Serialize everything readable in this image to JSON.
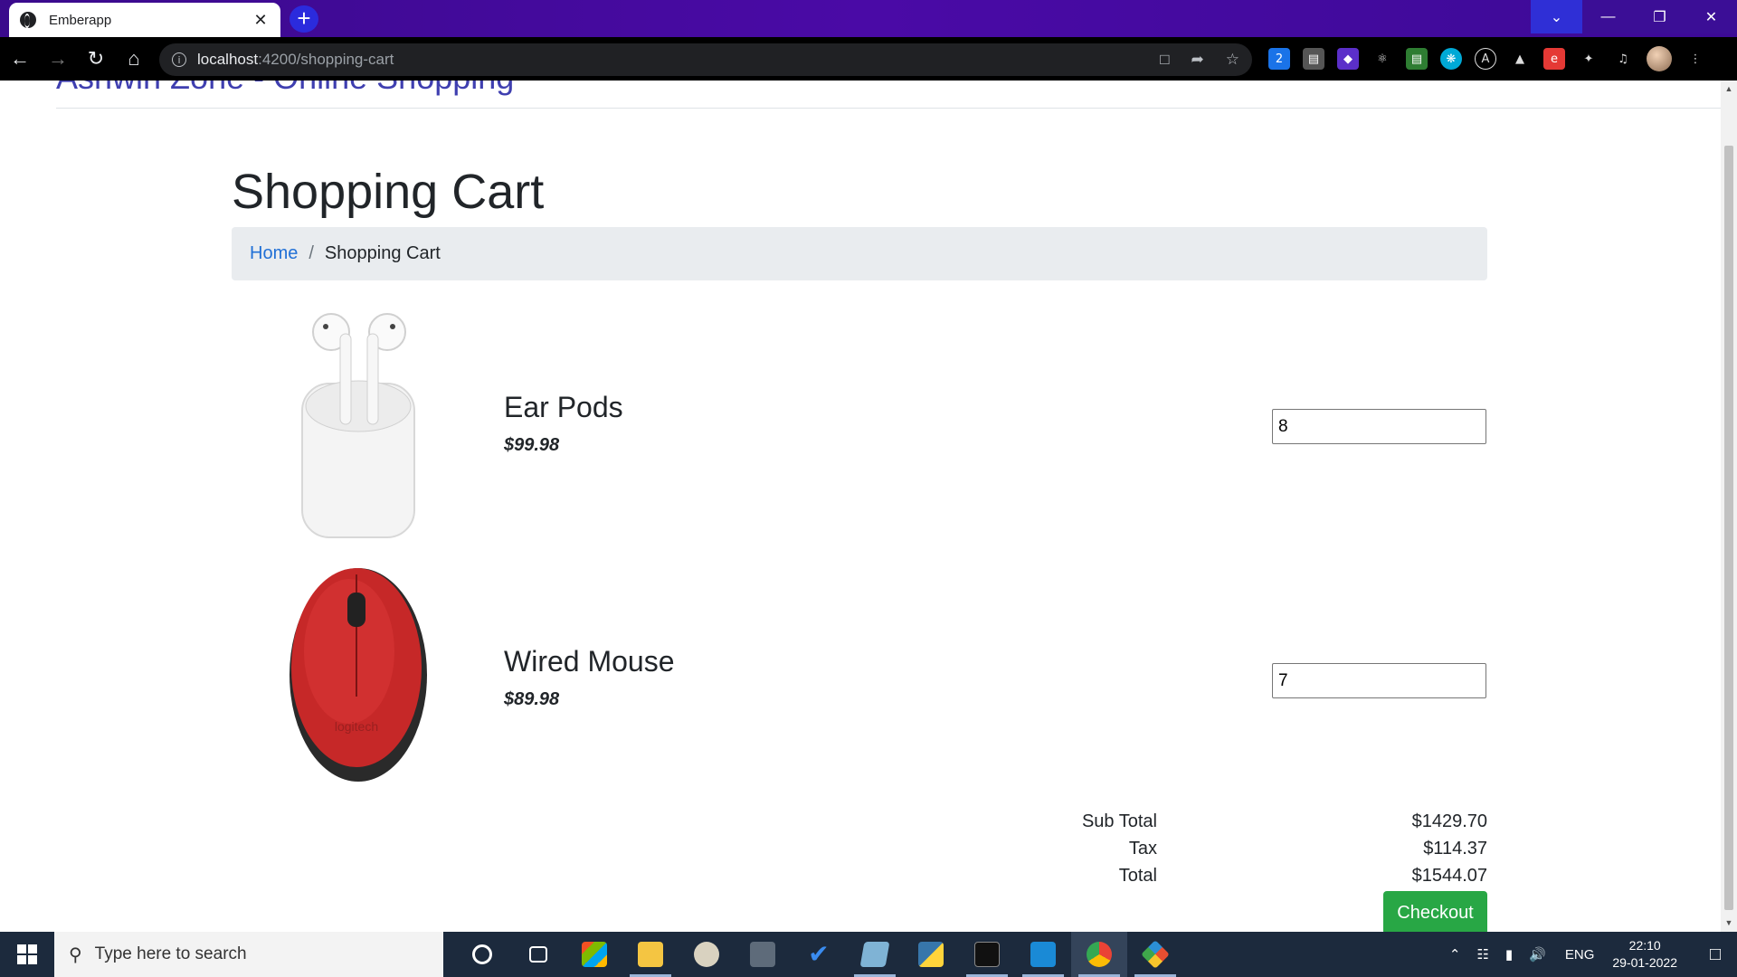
{
  "browser": {
    "tab_title": "Emberapp",
    "tab_close": "✕",
    "new_tab": "+",
    "url_host": "localhost",
    "url_path": ":4200/shopping-cart"
  },
  "site": {
    "brand": "Ashwin Zone - Online Shopping"
  },
  "page": {
    "title": "Shopping Cart",
    "breadcrumb": {
      "home": "Home",
      "separator": "/",
      "current": "Shopping Cart"
    }
  },
  "cart": {
    "items": [
      {
        "name": "Ear Pods",
        "price": "$99.98",
        "quantity": "8",
        "image": "earpods-image"
      },
      {
        "name": "Wired Mouse",
        "price": "$89.98",
        "quantity": "7",
        "image": "mouse-image"
      }
    ],
    "summary": {
      "subtotal_label": "Sub Total",
      "subtotal_value": "$1429.70",
      "tax_label": "Tax",
      "tax_value": "$114.37",
      "total_label": "Total",
      "total_value": "$1544.07"
    },
    "checkout_label": "Checkout"
  },
  "taskbar": {
    "search_placeholder": "Type here to search",
    "language": "ENG",
    "time": "22:10",
    "date": "29-01-2022"
  },
  "colors": {
    "accent_link": "#2170d6",
    "checkout_green": "#28a745",
    "brand": "#3f3fb0"
  }
}
